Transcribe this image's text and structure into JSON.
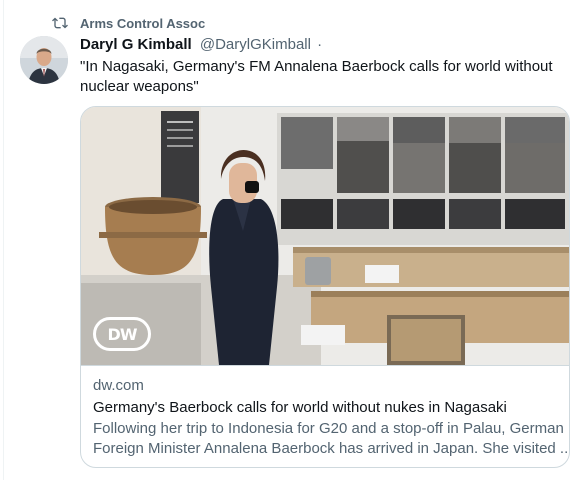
{
  "retweet": {
    "label": "Arms Control Assoc",
    "icon": "retweet-icon"
  },
  "tweet": {
    "author_name": "Daryl G Kimball",
    "author_handle": "@DarylGKimball",
    "separator": "·",
    "text": "\"In Nagasaki, Germany's FM Annalena Baerbock calls for world without nuclear weapons\""
  },
  "card": {
    "media_logo": "DW",
    "domain": "dw.com",
    "title": "Germany's Baerbock calls for world without nukes in Nagasaki",
    "description_line1": "Following her trip to Indonesia for G20 and a stop-off in Palau, German",
    "description_line2": "Foreign Minister Annalena Baerbock has arrived in Japan. She visited ..."
  },
  "colors": {
    "text_primary": "#0f1419",
    "text_secondary": "#536471",
    "border": "#cfd9de"
  }
}
